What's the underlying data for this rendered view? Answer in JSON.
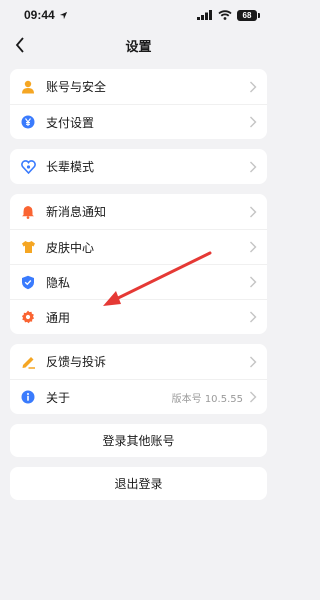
{
  "status": {
    "time": "09:44",
    "battery": "68"
  },
  "header": {
    "title": "设置"
  },
  "groups": [
    {
      "items": [
        {
          "label": "账号与安全",
          "icon": "user-icon",
          "color": "#f5a623"
        },
        {
          "label": "支付设置",
          "icon": "yuan-icon",
          "color": "#3a7bfd"
        }
      ]
    },
    {
      "items": [
        {
          "label": "长辈模式",
          "icon": "heart-icon",
          "color": "#3a7bfd"
        }
      ]
    },
    {
      "items": [
        {
          "label": "新消息通知",
          "icon": "bell-icon",
          "color": "#fa6432"
        },
        {
          "label": "皮肤中心",
          "icon": "shirt-icon",
          "color": "#f5a623"
        },
        {
          "label": "隐私",
          "icon": "shield-icon",
          "color": "#3a7bfd"
        },
        {
          "label": "通用",
          "icon": "gear-icon",
          "color": "#fa6432"
        }
      ]
    },
    {
      "items": [
        {
          "label": "反馈与投诉",
          "icon": "pen-icon",
          "color": "#f5a623"
        },
        {
          "label": "关于",
          "icon": "info-icon",
          "color": "#3a7bfd",
          "value": "版本号 10.5.55"
        }
      ]
    }
  ],
  "buttons": {
    "login_other": "登录其他账号",
    "logout": "退出登录"
  },
  "annotation": {
    "type": "red-arrow",
    "target": "通用",
    "color": "#e53935"
  }
}
